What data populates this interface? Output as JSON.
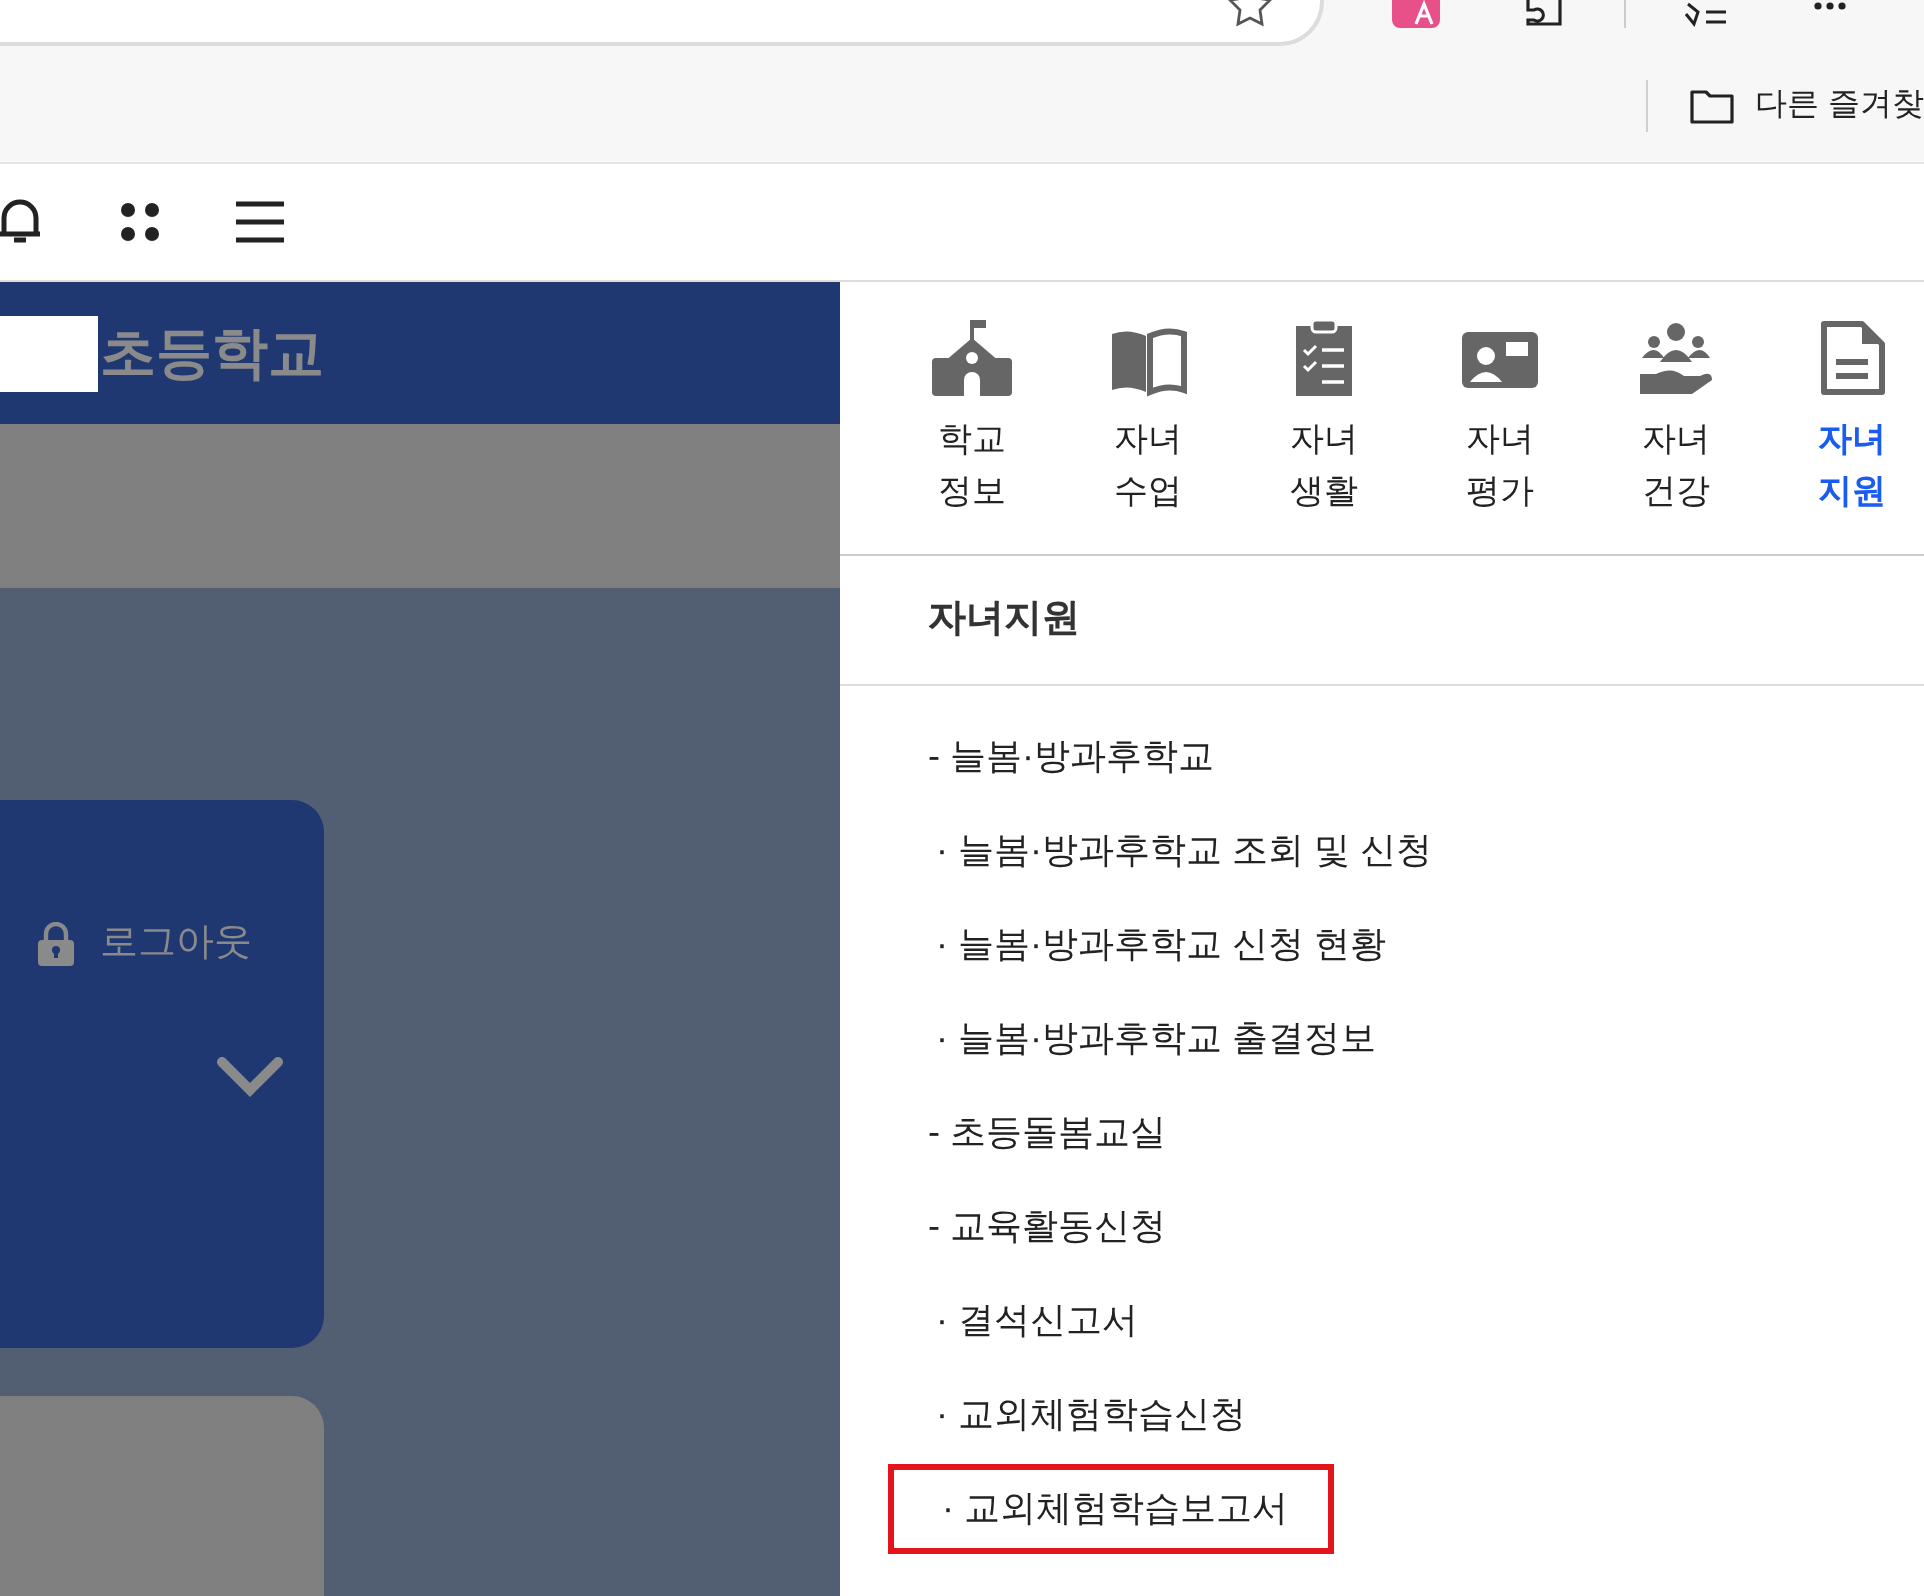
{
  "bookmarks_bar": {
    "folder": "다른 즐겨찾"
  },
  "school_header": {
    "name": "초등학교"
  },
  "account_card": {
    "logout": "로그아웃"
  },
  "menu_tabs": [
    {
      "label": "학교 정보",
      "kind": "school",
      "selected": false
    },
    {
      "label": "자녀 수업",
      "kind": "book",
      "selected": false
    },
    {
      "label": "자녀 생활",
      "kind": "clipboard",
      "selected": false
    },
    {
      "label": "자녀 평가",
      "kind": "idcard",
      "selected": false
    },
    {
      "label": "자녀 건강",
      "kind": "care",
      "selected": false
    },
    {
      "label": "자녀 지원",
      "kind": "document",
      "selected": true
    }
  ],
  "section_title": "자녀지원",
  "menu_items": [
    {
      "label": "- 늘봄·방과후학교",
      "kind": "section",
      "highlighted": false
    },
    {
      "label": "· 늘봄·방과후학교 조회 및 신청",
      "kind": "sub",
      "highlighted": false
    },
    {
      "label": "· 늘봄·방과후학교 신청 현황",
      "kind": "sub",
      "highlighted": false
    },
    {
      "label": "· 늘봄·방과후학교 출결정보",
      "kind": "sub",
      "highlighted": false
    },
    {
      "label": "- 초등돌봄교실",
      "kind": "section",
      "highlighted": false
    },
    {
      "label": "- 교육활동신청",
      "kind": "section",
      "highlighted": false
    },
    {
      "label": "· 결석신고서",
      "kind": "sub",
      "highlighted": false
    },
    {
      "label": "· 교외체험학습신청",
      "kind": "sub",
      "highlighted": false
    },
    {
      "label": "· 교외체험학습보고서",
      "kind": "sub",
      "highlighted": true
    }
  ]
}
